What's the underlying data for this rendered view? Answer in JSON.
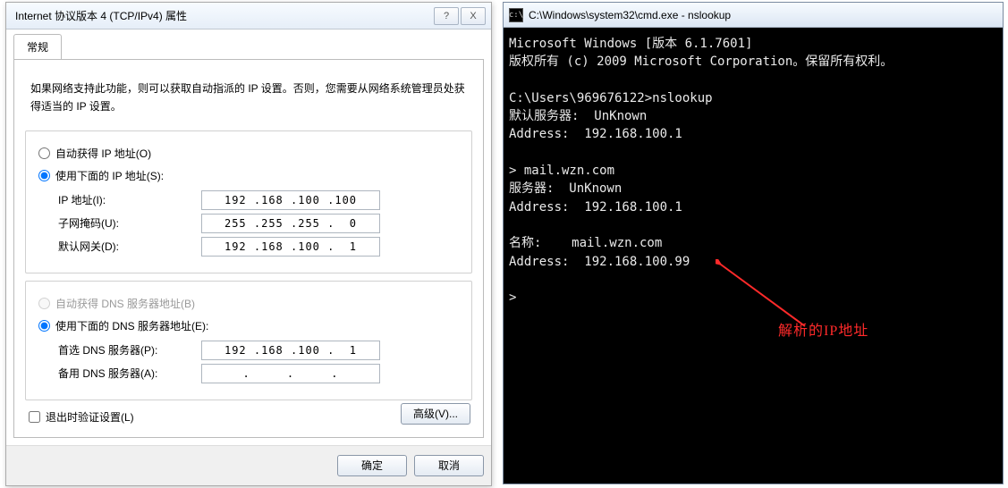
{
  "dialog": {
    "title": "Internet 协议版本 4 (TCP/IPv4) 属性",
    "help_icon": "?",
    "close_icon": "X",
    "tab_general": "常规",
    "description": "如果网络支持此功能，则可以获取自动指派的 IP 设置。否则，您需要从网络系统管理员处获得适当的 IP 设置。",
    "ip_group": {
      "auto_label": "自动获得 IP 地址(O)",
      "manual_label": "使用下面的 IP 地址(S):",
      "ip_label": "IP 地址(I):",
      "ip_value": "192 .168 .100 .100",
      "mask_label": "子网掩码(U):",
      "mask_value": "255 .255 .255 .  0",
      "gateway_label": "默认网关(D):",
      "gateway_value": "192 .168 .100 .  1"
    },
    "dns_group": {
      "auto_label": "自动获得 DNS 服务器地址(B)",
      "manual_label": "使用下面的 DNS 服务器地址(E):",
      "pref_label": "首选 DNS 服务器(P):",
      "pref_value": "192 .168 .100 .  1",
      "alt_label": "备用 DNS 服务器(A):",
      "alt_value": "  .     .     .  "
    },
    "validate_label": "退出时验证设置(L)",
    "advanced_btn": "高级(V)...",
    "ok_btn": "确定",
    "cancel_btn": "取消"
  },
  "cmd": {
    "title": "C:\\Windows\\system32\\cmd.exe - nslookup",
    "line1": "Microsoft Windows [版本 6.1.7601]",
    "line2": "版权所有 (c) 2009 Microsoft Corporation。保留所有权利。",
    "line3": "",
    "line4": "C:\\Users\\969676122>nslookup",
    "line5": "默认服务器:  UnKnown",
    "line6": "Address:  192.168.100.1",
    "line7": "",
    "line8": "> mail.wzn.com",
    "line9": "服务器:  UnKnown",
    "line10": "Address:  192.168.100.1",
    "line11": "",
    "line12": "名称:    mail.wzn.com",
    "line13": "Address:  192.168.100.99",
    "line14": "",
    "line15": ">"
  },
  "annotation": {
    "label": "解析的IP地址"
  }
}
